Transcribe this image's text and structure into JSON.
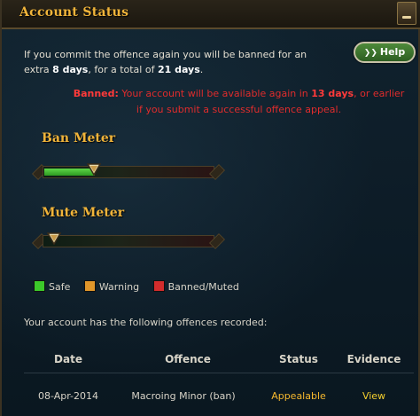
{
  "header": {
    "title": "Account Status"
  },
  "message": {
    "line1_pre": "If you commit the offence again you will be banned for an extra ",
    "line1_bold": "8 days",
    "line1_mid": ", for a total of ",
    "line1_bold2": "21 days",
    "line1_post": "."
  },
  "help": {
    "label": "Help"
  },
  "banned": {
    "prefix": "Banned:",
    "text_pre": " Your account will be available again in ",
    "days": "13 days",
    "text_post": ", or earlier if you submit a successful offence appeal."
  },
  "meters": [
    {
      "label": "Ban Meter",
      "level": 0.3
    },
    {
      "label": "Mute Meter",
      "level": 0.0
    }
  ],
  "legend": [
    {
      "label": "Safe",
      "color": "#3cc82a"
    },
    {
      "label": "Warning",
      "color": "#e0962a"
    },
    {
      "label": "Banned/Muted",
      "color": "#d22c2c"
    }
  ],
  "offences": {
    "intro": "Your account has the following offences recorded:",
    "columns": [
      "Date",
      "Offence",
      "Status",
      "Evidence"
    ],
    "rows": [
      {
        "date": "08-Apr-2014",
        "offence": "Macroing Minor (ban)",
        "status": "Appealable",
        "evidence": "View"
      }
    ]
  }
}
